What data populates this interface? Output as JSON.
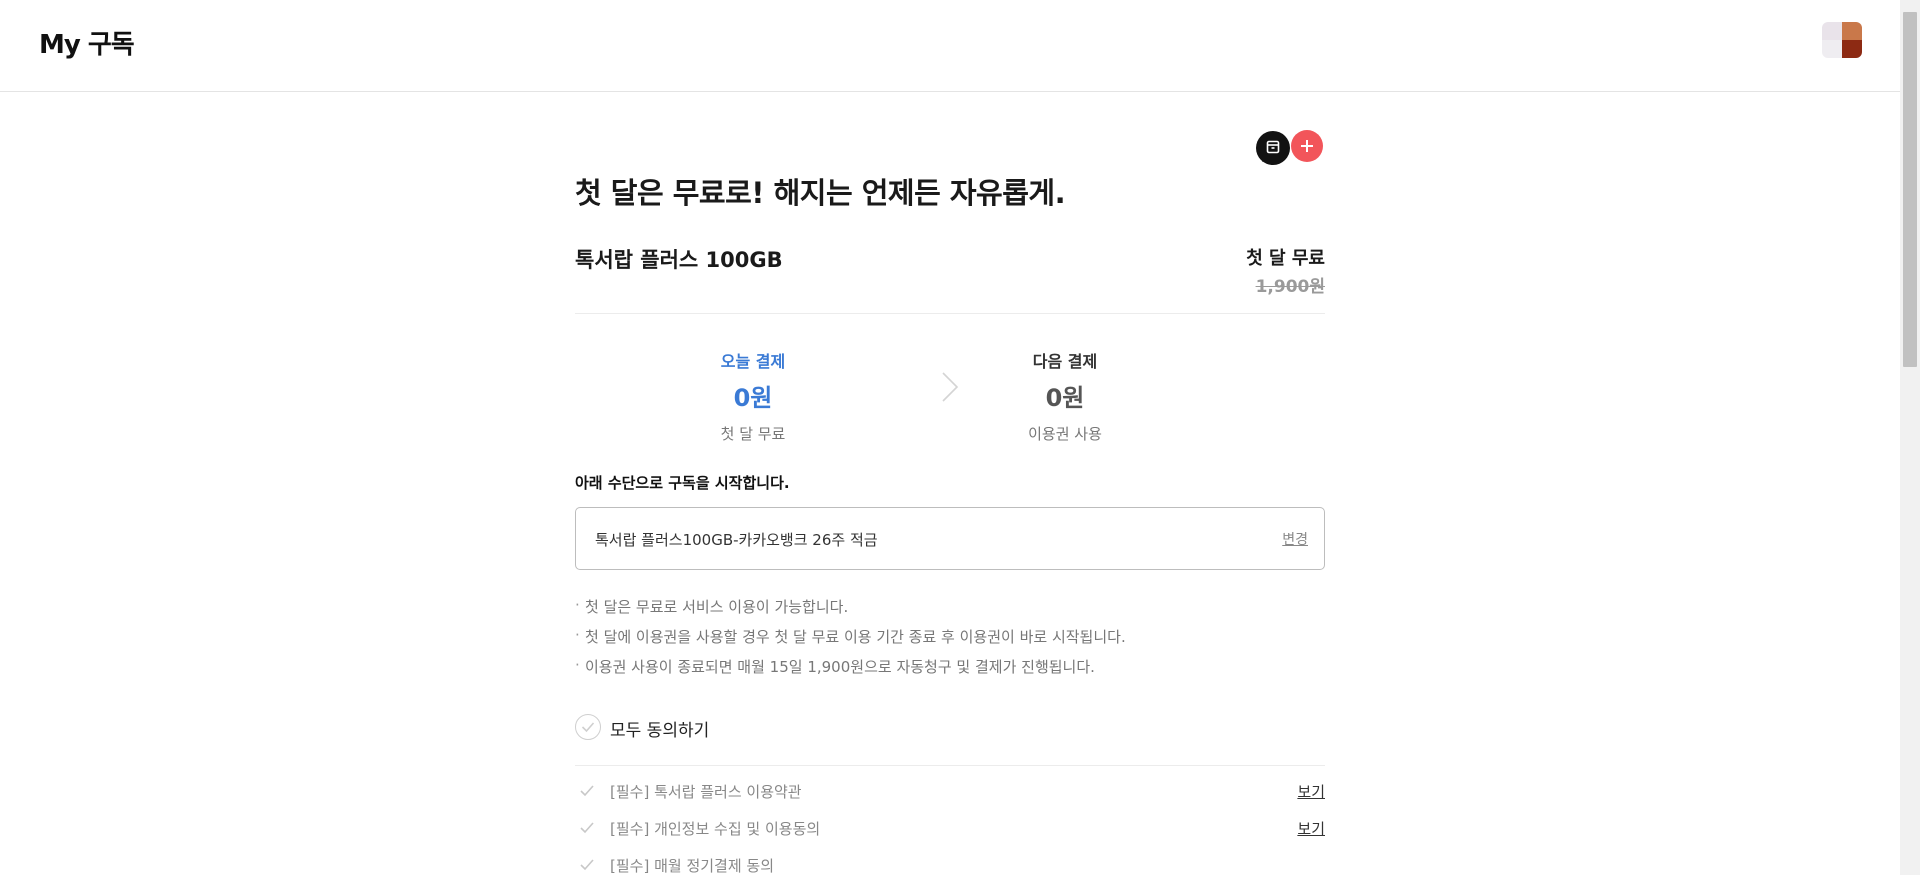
{
  "header": {
    "title": "My 구독"
  },
  "offer": {
    "headline": "첫 달은 무료로! 해지는 언제든 자유롭게.",
    "product_name": "톡서랍 플러스 100GB",
    "promo_label": "첫 달 무료",
    "original_price": "1,900원"
  },
  "payment": {
    "today_label": "오늘 결제",
    "today_amount": "0원",
    "today_sub": "첫 달 무료",
    "next_label": "다음 결제",
    "next_amount": "0원",
    "next_sub": "이용권 사용"
  },
  "method": {
    "title": "아래 수단으로 구독을 시작합니다.",
    "value": "톡서랍 플러스100GB-카카오뱅크 26주 적금",
    "change_label": "변경"
  },
  "notes": [
    "첫 달은 무료로 서비스 이용이 가능합니다.",
    "첫 달에 이용권을 사용할 경우 첫 달 무료 이용 기간 종료 후 이용권이 바로 시작됩니다.",
    "이용권 사용이 종료되면 매월 15일 1,900원으로 자동청구 및 결제가 진행됩니다."
  ],
  "agreement": {
    "all_label": "모두 동의하기",
    "items": [
      {
        "label": "[필수] 톡서랍 플러스 이용약관",
        "view": "보기"
      },
      {
        "label": "[필수] 개인정보 수집 및 이용동의",
        "view": "보기"
      },
      {
        "label": "[필수] 매월 정기결제 동의",
        "view": ""
      }
    ]
  },
  "colors": {
    "accent_blue": "#3a7ad5",
    "plus_button": "#f2555a",
    "chat_button": "#121212"
  },
  "icons": {
    "chat_fab": "chat-drawer-icon",
    "plus_fab": "plus-icon",
    "arrow": "chevron-right-icon",
    "check": "check-icon"
  }
}
